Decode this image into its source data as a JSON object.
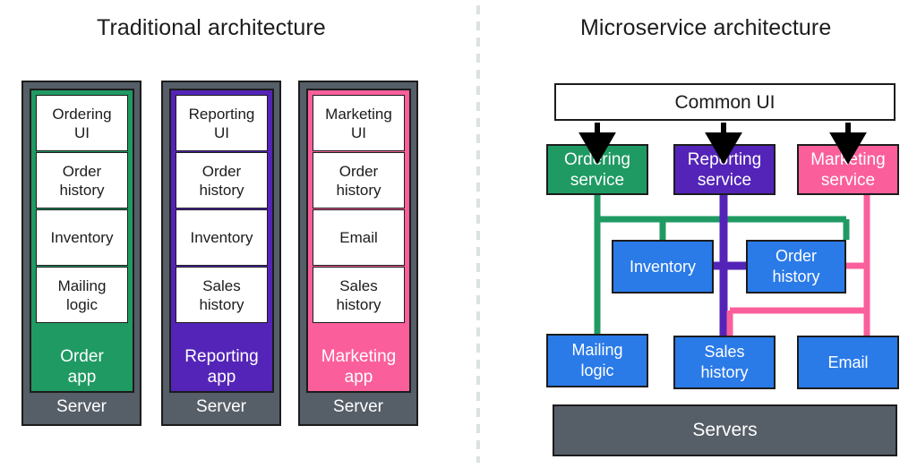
{
  "panels": {
    "left": {
      "title": "Traditional architecture",
      "servers": [
        {
          "app_label": "Order\napp",
          "server_label": "Server",
          "color": "#1f9a63",
          "cards": [
            "Ordering\nUI",
            "Order\nhistory",
            "Inventory",
            "Mailing\nlogic"
          ]
        },
        {
          "app_label": "Reporting\napp",
          "server_label": "Server",
          "color": "#5424b8",
          "cards": [
            "Reporting\nUI",
            "Order\nhistory",
            "Inventory",
            "Sales\nhistory"
          ]
        },
        {
          "app_label": "Marketing\napp",
          "server_label": "Server",
          "color": "#fa5f9b",
          "cards": [
            "Marketing\nUI",
            "Order\nhistory",
            "Email",
            "Sales\nhistory"
          ]
        }
      ]
    },
    "right": {
      "title": "Microservice architecture",
      "common_ui": "Common UI",
      "services": [
        {
          "label": "Ordering\nservice",
          "color": "#1f9a63"
        },
        {
          "label": "Reporting\nservice",
          "color": "#5424b8"
        },
        {
          "label": "Marketing\nservice",
          "color": "#fa5f9b"
        }
      ],
      "components": [
        {
          "label": "Inventory",
          "color": "#2a7ae8"
        },
        {
          "label": "Order\nhistory",
          "color": "#2a7ae8"
        },
        {
          "label": "Mailing\nlogic",
          "color": "#2a7ae8"
        },
        {
          "label": "Sales\nhistory",
          "color": "#2a7ae8"
        },
        {
          "label": "Email",
          "color": "#2a7ae8"
        }
      ],
      "servers_label": "Servers",
      "connections": [
        {
          "from": "Common UI",
          "to": "Ordering service",
          "color": "#000000",
          "style": "arrow"
        },
        {
          "from": "Common UI",
          "to": "Reporting service",
          "color": "#000000",
          "style": "arrow"
        },
        {
          "from": "Common UI",
          "to": "Marketing service",
          "color": "#000000",
          "style": "arrow"
        },
        {
          "from": "Ordering service",
          "to": "Inventory",
          "color": "#1f9a63",
          "style": "line"
        },
        {
          "from": "Ordering service",
          "to": "Order history",
          "color": "#1f9a63",
          "style": "line"
        },
        {
          "from": "Ordering service",
          "to": "Mailing logic",
          "color": "#1f9a63",
          "style": "line"
        },
        {
          "from": "Reporting service",
          "to": "Inventory",
          "color": "#5424b8",
          "style": "line"
        },
        {
          "from": "Reporting service",
          "to": "Order history",
          "color": "#5424b8",
          "style": "line"
        },
        {
          "from": "Reporting service",
          "to": "Sales history",
          "color": "#5424b8",
          "style": "line"
        },
        {
          "from": "Marketing service",
          "to": "Order history",
          "color": "#fa5f9b",
          "style": "line"
        },
        {
          "from": "Marketing service",
          "to": "Sales history",
          "color": "#fa5f9b",
          "style": "line"
        },
        {
          "from": "Marketing service",
          "to": "Email",
          "color": "#fa5f9b",
          "style": "line"
        }
      ]
    }
  },
  "theme": {
    "background": "#ffffff",
    "text_dark": "#1c1c1c",
    "text_light": "#ffffff",
    "server_gray": "#565e68",
    "green": "#1f9a63",
    "purple": "#5424b8",
    "pink": "#fa5f9b",
    "blue": "#2a7ae8",
    "divider": "#dce1e1"
  }
}
